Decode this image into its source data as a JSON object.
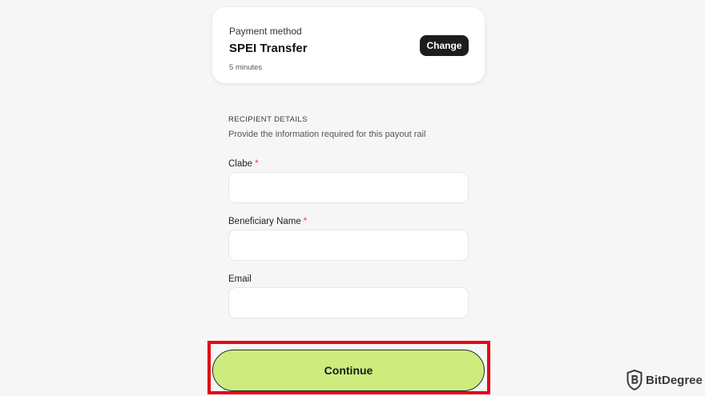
{
  "payment_method": {
    "label": "Payment method",
    "name": "SPEI Transfer",
    "time": "5 minutes",
    "change_label": "Change"
  },
  "recipient": {
    "title": "RECIPIENT DETAILS",
    "subtitle": "Provide the information required for this payout rail",
    "fields": [
      {
        "label": "Clabe",
        "required": "*",
        "value": ""
      },
      {
        "label": "Beneficiary Name",
        "required": "*",
        "value": ""
      },
      {
        "label": "Email",
        "value": ""
      }
    ]
  },
  "continue_label": "Continue",
  "watermark": {
    "text": "BitDegree",
    "icon": "bitdegree-shield-icon"
  },
  "colors": {
    "continue_bg": "#cdec7d",
    "highlight_border": "#e30613",
    "change_bg": "#1d1d1d",
    "required_star": "#e04848"
  }
}
